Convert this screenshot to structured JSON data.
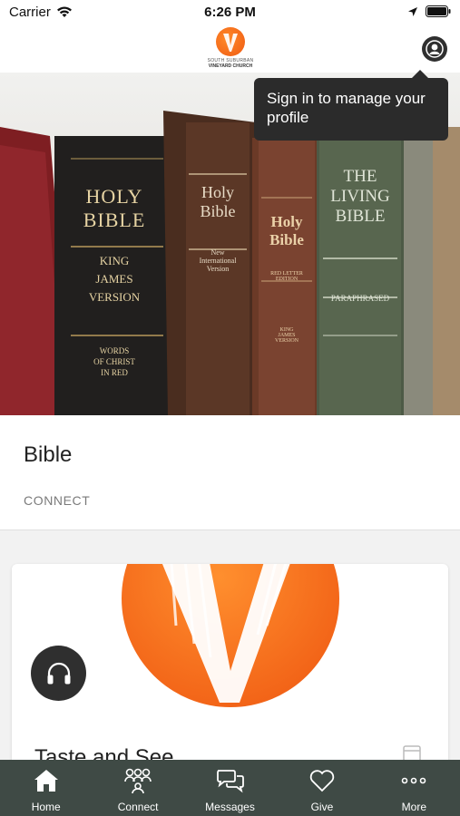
{
  "status_bar": {
    "carrier": "Carrier",
    "time": "6:26 PM"
  },
  "header": {
    "logo_line1": "SOUTH SUBURBAN",
    "logo_line2": "VINEYARD CHURCH"
  },
  "tooltip": {
    "text": "Sign in to manage your profile"
  },
  "hero_card": {
    "title": "Bible",
    "category": "CONNECT",
    "books": [
      {
        "line1": "HOLY",
        "line2": "BIBLE",
        "line3": "KING",
        "line4": "JAMES",
        "line5": "VERSION",
        "footer1": "WORDS",
        "footer2": "OF CHRIST",
        "footer3": "IN RED"
      },
      {
        "line1": "Holy",
        "line2": "Bible",
        "sub1": "New",
        "sub2": "International",
        "sub3": "Version"
      },
      {
        "line1": "Holy",
        "line2": "Bible",
        "sub1": "RED LETTER",
        "sub2": "EDITION",
        "sub3": "KING",
        "sub4": "JAMES",
        "sub5": "VERSION"
      },
      {
        "line1": "THE",
        "line2": "LIVING",
        "line3": "BIBLE",
        "sub1": "PARAPHRASED"
      }
    ]
  },
  "content_card": {
    "title": "Taste and See"
  },
  "tab_bar": {
    "tabs": [
      {
        "label": "Home",
        "icon": "home-icon"
      },
      {
        "label": "Connect",
        "icon": "connect-icon"
      },
      {
        "label": "Messages",
        "icon": "messages-icon"
      },
      {
        "label": "Give",
        "icon": "heart-icon"
      },
      {
        "label": "More",
        "icon": "more-icon"
      }
    ]
  },
  "colors": {
    "accent": "#ef5a12",
    "tab_bar": "#3f4a45",
    "tooltip": "#2b2b2b"
  }
}
